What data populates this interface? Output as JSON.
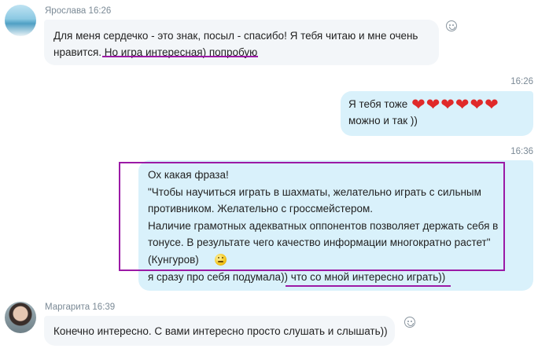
{
  "messages": [
    {
      "sender": "Ярослава",
      "time": "16:26",
      "lines": [
        "Для меня сердечко - это знак, посыл - спасибо! Я тебя читаю и мне очень",
        "нравится. Но игра интересная) попробую"
      ]
    },
    {
      "time": "16:26",
      "lines": [
        "Я тебя тоже",
        "можно и так ))"
      ],
      "hearts": [
        "❤",
        "❤",
        "❤",
        "❤",
        "❤",
        "❤"
      ],
      "heart_color": "#e02929"
    },
    {
      "time": "16:36",
      "lines": [
        "Ох какая фраза!",
        "\"Чтобы научиться играть в шахматы, желательно играть с сильным",
        "противником. Желательно с гроссмейстером.",
        "Наличие грамотных адекватных оппонентов позволяет держать себя в",
        "тонусе. В результате чего качество информации многократно растет\"",
        "(Кунгуров)",
        "я сразу про себя подумала)) что со мной интересно играть))"
      ],
      "emoji": "smiling-face-icon"
    },
    {
      "sender": "Маргарита",
      "time": "16:39",
      "lines": [
        "Конечно интересно. С вами интересно просто слушать и слышать))"
      ]
    }
  ],
  "colors": {
    "incoming_bubble": "#f3f6f9",
    "outgoing_bubble": "#d9f1fb",
    "annotation": "#9b1aa6",
    "meta_text": "#7b8a96"
  },
  "icons": {
    "reaction": "smiley-outline-icon"
  }
}
